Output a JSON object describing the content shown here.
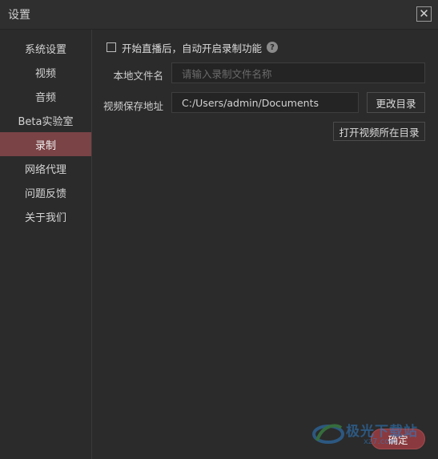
{
  "window": {
    "title": "设置",
    "close_glyph": "✕"
  },
  "sidebar": {
    "items": [
      {
        "label": "系统设置"
      },
      {
        "label": "视频"
      },
      {
        "label": "音频"
      },
      {
        "label": "Beta实验室"
      },
      {
        "label": "录制",
        "active": true
      },
      {
        "label": "网络代理"
      },
      {
        "label": "问题反馈"
      },
      {
        "label": "关于我们"
      }
    ]
  },
  "record": {
    "auto_record_label": "开始直播后，自动开启录制功能",
    "auto_record_checked": false,
    "help_glyph": "?",
    "filename_label": "本地文件名",
    "filename_placeholder": "请输入录制文件名称",
    "filename_value": "",
    "save_path_label": "视频保存地址",
    "save_path_value": "C:/Users/admin/Documents",
    "change_dir_button": "更改目录",
    "open_dir_button": "打开视频所在目录"
  },
  "footer": {
    "ok_button": "确定"
  },
  "watermark": {
    "text": "极光下载站",
    "subtext": "xz7.com"
  },
  "colors": {
    "background": "#2b2b2b",
    "active_nav": "#7a4346",
    "accent": "#8a3a3e",
    "watermark": "#2d7ec8"
  },
  "icons": {
    "close": "close-icon",
    "help": "help-icon",
    "checkbox": "checkbox-unchecked-icon"
  }
}
